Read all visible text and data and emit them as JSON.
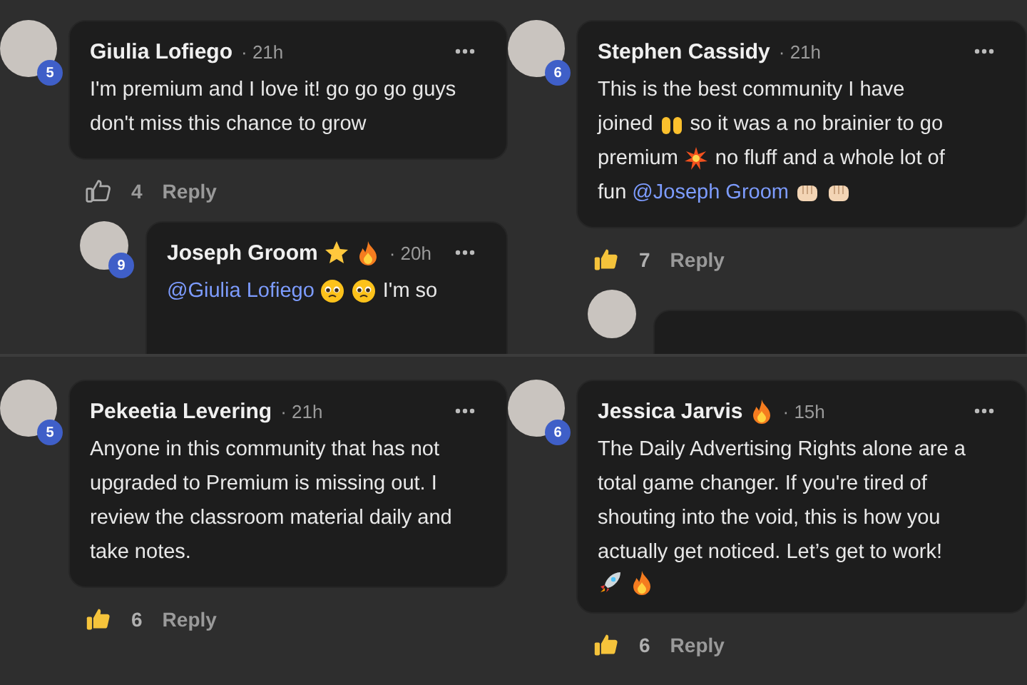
{
  "panels": [
    {
      "comments": [
        {
          "author": "Giulia Lofiego",
          "time": "· 21h",
          "badge": "5",
          "lines": [
            [
              {
                "kind": "text",
                "text": "I'm premium and I love it! go go go guys"
              }
            ],
            [
              {
                "kind": "text",
                "text": "don't miss this chance to grow"
              }
            ]
          ],
          "likes": "4",
          "liked": false,
          "reply_label": "Reply",
          "replies": [
            {
              "kind": "full",
              "author": "Joseph Groom",
              "name_emojis": [
                {
                  "kind": "star"
                },
                {
                  "kind": "fire"
                }
              ],
              "time": "· 20h",
              "badge": "9",
              "lines": [
                [
                  {
                    "kind": "mention",
                    "text": "@Giulia Lofiego"
                  },
                  {
                    "kind": "pleading"
                  },
                  {
                    "kind": "pleading"
                  },
                  {
                    "kind": "text",
                    "text": "I'm so"
                  }
                ]
              ]
            }
          ]
        }
      ]
    },
    {
      "comments": [
        {
          "author": "Stephen Cassidy",
          "time": "· 21h",
          "badge": "6",
          "lines": [
            [
              {
                "kind": "text",
                "text": "This is the best community I have"
              }
            ],
            [
              {
                "kind": "text",
                "text": "joined"
              },
              {
                "kind": "raised_hands"
              },
              {
                "kind": "text",
                "text": "so it was a no brainier to go"
              }
            ],
            [
              {
                "kind": "text",
                "text": "premium"
              },
              {
                "kind": "collision"
              },
              {
                "kind": "text",
                "text": "no fluff and a whole lot of"
              }
            ],
            [
              {
                "kind": "text",
                "text": "fun"
              },
              {
                "kind": "mention",
                "text": "@Joseph Groom"
              },
              {
                "kind": "fist"
              },
              {
                "kind": "fist"
              }
            ]
          ],
          "likes": "7",
          "liked": true,
          "reply_label": "Reply",
          "replies": [
            {
              "kind": "cut"
            }
          ]
        }
      ]
    },
    {
      "comments": [
        {
          "author": "Pekeetia Levering",
          "time": "· 21h",
          "badge": "5",
          "lines": [
            [
              {
                "kind": "text",
                "text": "Anyone in this community that has not"
              }
            ],
            [
              {
                "kind": "text",
                "text": "upgraded to Premium is missing out. I"
              }
            ],
            [
              {
                "kind": "text",
                "text": "review the classroom material daily and"
              }
            ],
            [
              {
                "kind": "text",
                "text": "take notes."
              }
            ]
          ],
          "likes": "6",
          "liked": true,
          "reply_label": "Reply"
        }
      ]
    },
    {
      "comments": [
        {
          "author": "Jessica Jarvis",
          "name_emojis": [
            {
              "kind": "fire"
            }
          ],
          "time": "· 15h",
          "badge": "6",
          "lines": [
            [
              {
                "kind": "text",
                "text": "The Daily Advertising Rights alone are a"
              }
            ],
            [
              {
                "kind": "text",
                "text": "total game changer. If you're tired of"
              }
            ],
            [
              {
                "kind": "text",
                "text": "shouting into the void, this is how you"
              }
            ],
            [
              {
                "kind": "text",
                "text": "actually get noticed. Let’s get to work!"
              }
            ],
            [
              {
                "kind": "rocket"
              },
              {
                "kind": "fire"
              }
            ]
          ],
          "likes": "6",
          "liked": true,
          "reply_label": "Reply"
        }
      ]
    }
  ]
}
